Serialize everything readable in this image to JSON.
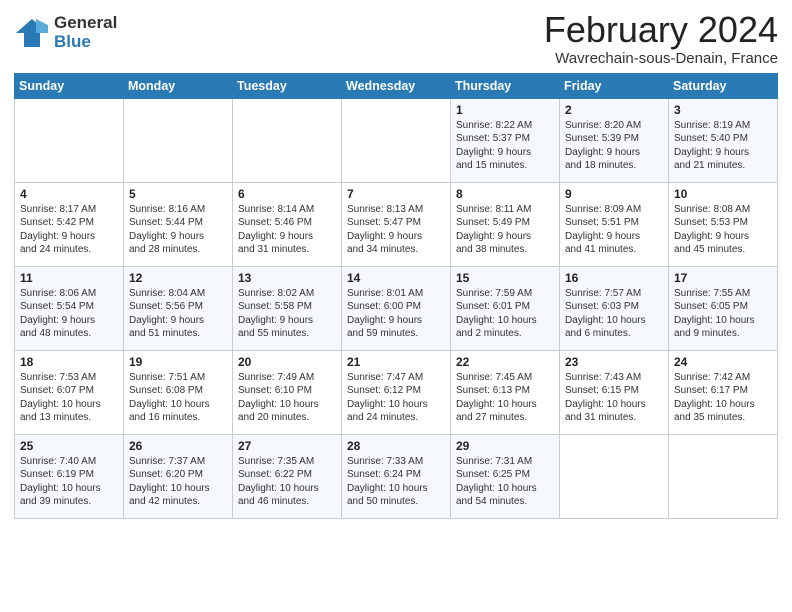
{
  "logo": {
    "general": "General",
    "blue": "Blue"
  },
  "title": "February 2024",
  "subtitle": "Wavrechain-sous-Denain, France",
  "days_of_week": [
    "Sunday",
    "Monday",
    "Tuesday",
    "Wednesday",
    "Thursday",
    "Friday",
    "Saturday"
  ],
  "weeks": [
    [
      {
        "day": "",
        "info": ""
      },
      {
        "day": "",
        "info": ""
      },
      {
        "day": "",
        "info": ""
      },
      {
        "day": "",
        "info": ""
      },
      {
        "day": "1",
        "info": "Sunrise: 8:22 AM\nSunset: 5:37 PM\nDaylight: 9 hours\nand 15 minutes."
      },
      {
        "day": "2",
        "info": "Sunrise: 8:20 AM\nSunset: 5:39 PM\nDaylight: 9 hours\nand 18 minutes."
      },
      {
        "day": "3",
        "info": "Sunrise: 8:19 AM\nSunset: 5:40 PM\nDaylight: 9 hours\nand 21 minutes."
      }
    ],
    [
      {
        "day": "4",
        "info": "Sunrise: 8:17 AM\nSunset: 5:42 PM\nDaylight: 9 hours\nand 24 minutes."
      },
      {
        "day": "5",
        "info": "Sunrise: 8:16 AM\nSunset: 5:44 PM\nDaylight: 9 hours\nand 28 minutes."
      },
      {
        "day": "6",
        "info": "Sunrise: 8:14 AM\nSunset: 5:46 PM\nDaylight: 9 hours\nand 31 minutes."
      },
      {
        "day": "7",
        "info": "Sunrise: 8:13 AM\nSunset: 5:47 PM\nDaylight: 9 hours\nand 34 minutes."
      },
      {
        "day": "8",
        "info": "Sunrise: 8:11 AM\nSunset: 5:49 PM\nDaylight: 9 hours\nand 38 minutes."
      },
      {
        "day": "9",
        "info": "Sunrise: 8:09 AM\nSunset: 5:51 PM\nDaylight: 9 hours\nand 41 minutes."
      },
      {
        "day": "10",
        "info": "Sunrise: 8:08 AM\nSunset: 5:53 PM\nDaylight: 9 hours\nand 45 minutes."
      }
    ],
    [
      {
        "day": "11",
        "info": "Sunrise: 8:06 AM\nSunset: 5:54 PM\nDaylight: 9 hours\nand 48 minutes."
      },
      {
        "day": "12",
        "info": "Sunrise: 8:04 AM\nSunset: 5:56 PM\nDaylight: 9 hours\nand 51 minutes."
      },
      {
        "day": "13",
        "info": "Sunrise: 8:02 AM\nSunset: 5:58 PM\nDaylight: 9 hours\nand 55 minutes."
      },
      {
        "day": "14",
        "info": "Sunrise: 8:01 AM\nSunset: 6:00 PM\nDaylight: 9 hours\nand 59 minutes."
      },
      {
        "day": "15",
        "info": "Sunrise: 7:59 AM\nSunset: 6:01 PM\nDaylight: 10 hours\nand 2 minutes."
      },
      {
        "day": "16",
        "info": "Sunrise: 7:57 AM\nSunset: 6:03 PM\nDaylight: 10 hours\nand 6 minutes."
      },
      {
        "day": "17",
        "info": "Sunrise: 7:55 AM\nSunset: 6:05 PM\nDaylight: 10 hours\nand 9 minutes."
      }
    ],
    [
      {
        "day": "18",
        "info": "Sunrise: 7:53 AM\nSunset: 6:07 PM\nDaylight: 10 hours\nand 13 minutes."
      },
      {
        "day": "19",
        "info": "Sunrise: 7:51 AM\nSunset: 6:08 PM\nDaylight: 10 hours\nand 16 minutes."
      },
      {
        "day": "20",
        "info": "Sunrise: 7:49 AM\nSunset: 6:10 PM\nDaylight: 10 hours\nand 20 minutes."
      },
      {
        "day": "21",
        "info": "Sunrise: 7:47 AM\nSunset: 6:12 PM\nDaylight: 10 hours\nand 24 minutes."
      },
      {
        "day": "22",
        "info": "Sunrise: 7:45 AM\nSunset: 6:13 PM\nDaylight: 10 hours\nand 27 minutes."
      },
      {
        "day": "23",
        "info": "Sunrise: 7:43 AM\nSunset: 6:15 PM\nDaylight: 10 hours\nand 31 minutes."
      },
      {
        "day": "24",
        "info": "Sunrise: 7:42 AM\nSunset: 6:17 PM\nDaylight: 10 hours\nand 35 minutes."
      }
    ],
    [
      {
        "day": "25",
        "info": "Sunrise: 7:40 AM\nSunset: 6:19 PM\nDaylight: 10 hours\nand 39 minutes."
      },
      {
        "day": "26",
        "info": "Sunrise: 7:37 AM\nSunset: 6:20 PM\nDaylight: 10 hours\nand 42 minutes."
      },
      {
        "day": "27",
        "info": "Sunrise: 7:35 AM\nSunset: 6:22 PM\nDaylight: 10 hours\nand 46 minutes."
      },
      {
        "day": "28",
        "info": "Sunrise: 7:33 AM\nSunset: 6:24 PM\nDaylight: 10 hours\nand 50 minutes."
      },
      {
        "day": "29",
        "info": "Sunrise: 7:31 AM\nSunset: 6:25 PM\nDaylight: 10 hours\nand 54 minutes."
      },
      {
        "day": "",
        "info": ""
      },
      {
        "day": "",
        "info": ""
      }
    ]
  ]
}
